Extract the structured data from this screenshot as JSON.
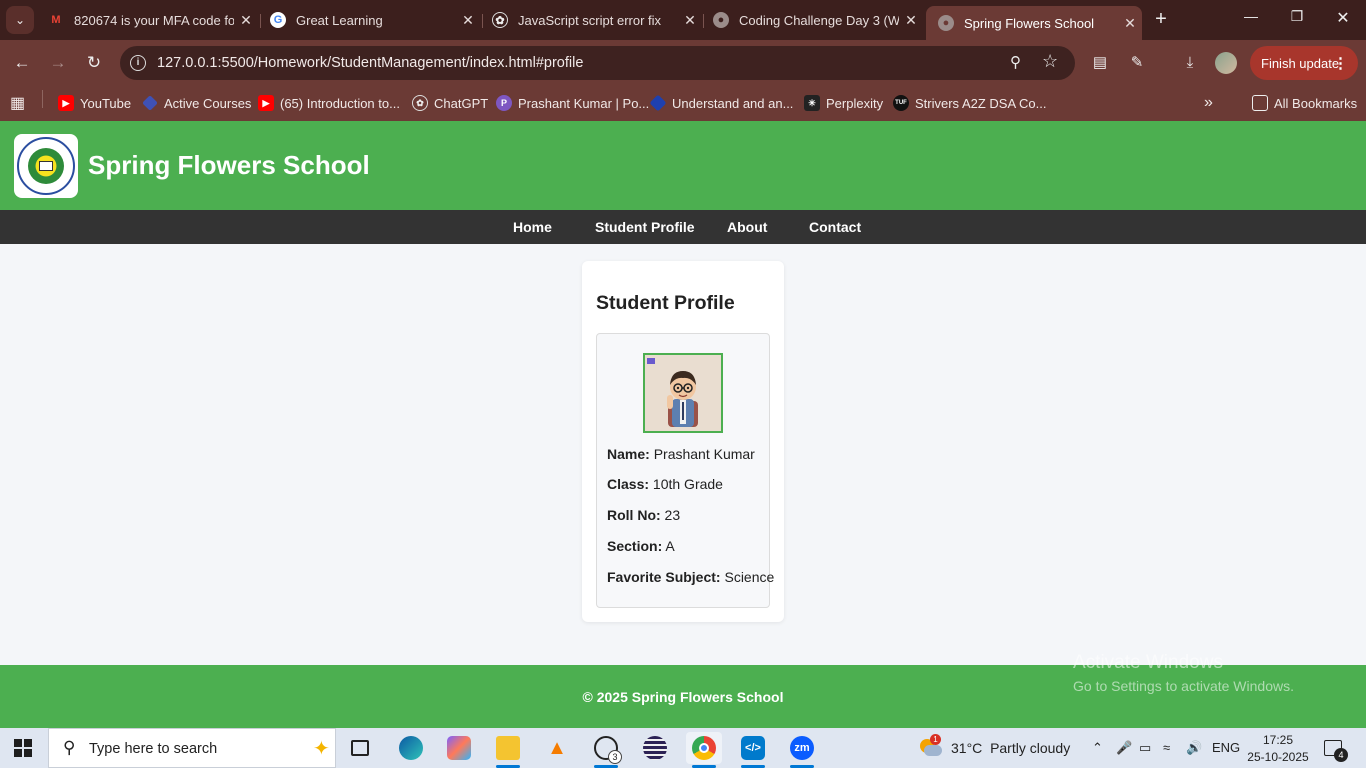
{
  "browser": {
    "tabs": [
      {
        "title": "820674 is your MFA code for",
        "favicon": "gmail-icon"
      },
      {
        "title": "Great Learning",
        "favicon": "google-icon"
      },
      {
        "title": "JavaScript script error fix",
        "favicon": "chatgpt-icon"
      },
      {
        "title": "Coding Challenge Day 3 (We",
        "favicon": "globe-icon"
      },
      {
        "title": "Spring Flowers School",
        "favicon": "globe-icon",
        "active": true
      }
    ],
    "url": "127.0.0.1:5500/Homework/StudentManagement/index.html#profile",
    "finish_update_label": "Finish update",
    "bookmarks": [
      {
        "label": "YouTube",
        "icon": "youtube-icon"
      },
      {
        "label": "Active Courses",
        "icon": "course-icon"
      },
      {
        "label": "(65) Introduction to...",
        "icon": "youtube-icon"
      },
      {
        "label": "ChatGPT",
        "icon": "chatgpt-icon"
      },
      {
        "label": "Prashant Kumar | Po...",
        "icon": "portfolio-icon"
      },
      {
        "label": "Understand and an...",
        "icon": "diamond-icon"
      },
      {
        "label": "Perplexity",
        "icon": "perplexity-icon"
      },
      {
        "label": "Strivers A2Z DSA Co...",
        "icon": "tuf-icon"
      }
    ],
    "all_bookmarks_label": "All Bookmarks"
  },
  "site": {
    "title": "Spring Flowers School",
    "nav": [
      "Home",
      "Student Profile",
      "About",
      "Contact"
    ],
    "profile": {
      "heading": "Student Profile",
      "fields": [
        {
          "label": "Name:",
          "value": "Prashant Kumar"
        },
        {
          "label": "Class:",
          "value": "10th Grade"
        },
        {
          "label": "Roll No:",
          "value": "23"
        },
        {
          "label": "Section:",
          "value": "A"
        },
        {
          "label": "Favorite Subject:",
          "value": "Science"
        }
      ]
    },
    "footer": "© 2025 Spring Flowers School",
    "colors": {
      "header": "#4caf50",
      "nav": "#333333",
      "footer": "#4caf50"
    }
  },
  "watermark": {
    "line1": "Activate Windows",
    "line2": "Go to Settings to activate Windows."
  },
  "taskbar": {
    "search_placeholder": "Type here to search",
    "whatsapp_badge": "3",
    "weather_temp": "31°C",
    "weather_desc": "Partly cloudy",
    "weather_alert": "1",
    "language": "ENG",
    "time": "17:25",
    "date": "25-10-2025",
    "notifications": "4"
  }
}
